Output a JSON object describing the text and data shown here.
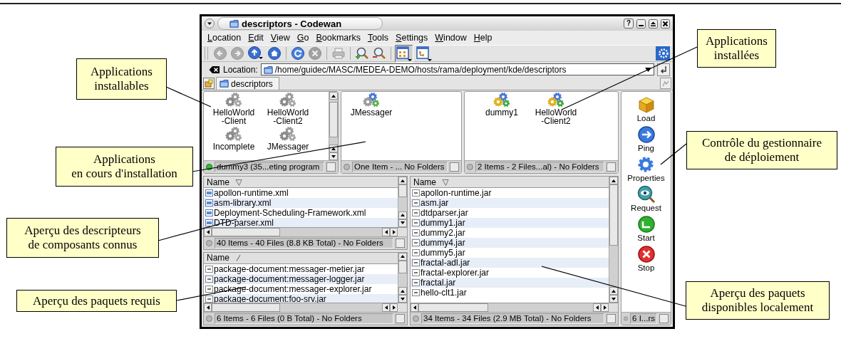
{
  "window": {
    "title": "descriptors - Codewan",
    "help": "?"
  },
  "menu": [
    "Location",
    "Edit",
    "View",
    "Go",
    "Bookmarks",
    "Tools",
    "Settings",
    "Window",
    "Help"
  ],
  "toolbar": [
    {
      "disabled": true,
      "pressed": false
    },
    {
      "disabled": true,
      "pressed": false
    },
    {
      "disabled": false,
      "pressed": false
    },
    {
      "disabled": false,
      "pressed": false
    },
    {
      "disabled": false,
      "pressed": false
    },
    {
      "disabled": true,
      "pressed": false
    },
    {
      "disabled": true,
      "pressed": false
    },
    {
      "disabled": false,
      "pressed": false
    },
    {
      "disabled": false,
      "pressed": false
    },
    {
      "disabled": false,
      "pressed": true
    },
    {
      "disabled": false,
      "pressed": false
    }
  ],
  "location": {
    "label": "Location:",
    "value": "/home/guidec/MASC/MEDEA-DEMO/hosts/rama/deployment/kde/descriptors"
  },
  "tabs": [
    {
      "label": "descriptors",
      "selected": true
    }
  ],
  "icon_panes": [
    {
      "kind": "installable",
      "scrollable": true,
      "items": [
        "HelloWorld\n-Client",
        "HelloWorld\n-Client2",
        "Incomplete",
        "JMessager"
      ],
      "status": {
        "text": "dummy3 (35...eting program",
        "active": true,
        "checked": false
      }
    },
    {
      "kind": "installing",
      "scrollable": false,
      "items": [
        "JMessager"
      ],
      "status": {
        "text": "One Item - ... No Folders",
        "active": false,
        "checked": false
      }
    },
    {
      "kind": "installed",
      "scrollable": false,
      "items": [
        "dummy1",
        "HelloWorld\n-Client2"
      ],
      "status": {
        "text": "2 Items - 2 Files...al) - No Folders",
        "active": false,
        "checked": false
      }
    }
  ],
  "lists": [
    {
      "column": "Name",
      "sort_descending": true,
      "kind": "xml",
      "rows": [
        "apollon-runtime.xml",
        "asm-library.xml",
        "Deployment-Scheduling-Framework.xml",
        "DTD-parser.xml"
      ],
      "status": {
        "text": "40 Items - 40 Files (8.8 KB Total) - No Folders",
        "active": false,
        "checked": false
      }
    },
    {
      "column": "Name",
      "sort_descending": false,
      "kind": "jar",
      "rows": [
        "package-document:messager-metier.jar",
        "package-document:messager-logger.jar",
        "package-document:messager-explorer.jar",
        "package-document:foo-srv.jar"
      ],
      "status": {
        "text": "6 Items - 6 Files (0 B Total) - No Folders",
        "active": false,
        "checked": false
      }
    },
    {
      "column": "Name",
      "sort_descending": true,
      "kind": "jar",
      "rows": [
        "apollon-runtime.jar",
        "asm.jar",
        "dtdparser.jar",
        "dummy1.jar",
        "dummy2.jar",
        "dummy4.jar",
        "dummy5.jar",
        "fractal-adl.jar",
        "fractal-explorer.jar",
        "fractal.jar",
        "hello-clt1.jar"
      ],
      "status": {
        "text": "34 Items - 34 Files (2.9 MB Total) - No Folders",
        "active": false,
        "checked": false
      }
    }
  ],
  "actions": [
    "Load",
    "Ping",
    "Properties",
    "Request",
    "Start",
    "Stop"
  ],
  "actions_status": {
    "text": "6 I...rs",
    "active": false,
    "checked": false
  },
  "annotations": [
    {
      "text": "Applications\ninstallables"
    },
    {
      "text": "Applications\nen cours d'installation"
    },
    {
      "text": "Aperçu des descripteurs\nde composants connus"
    },
    {
      "text": "Aperçu des paquets requis"
    },
    {
      "text": "Applications\ninstallées"
    },
    {
      "text": "Contrôle du gestionnaire\nde déploiement"
    },
    {
      "text": "Aperçu des paquets\ndisponibles localement"
    }
  ]
}
